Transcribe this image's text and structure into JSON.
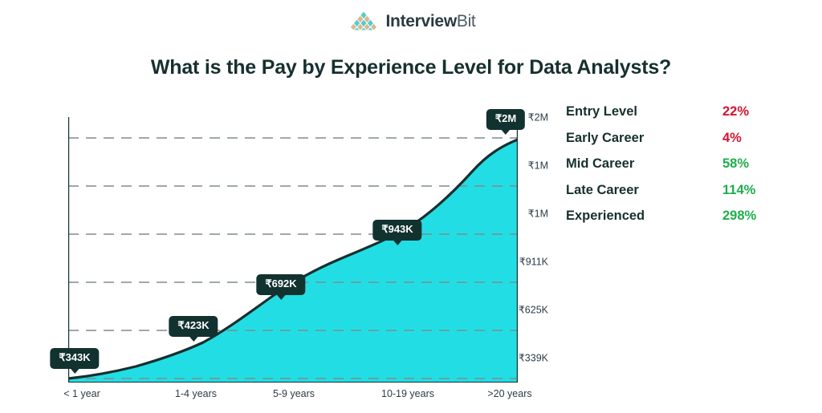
{
  "brand": {
    "logo_icon": "interviewbit-pyramid-logo-icon",
    "name_bold": "Interview",
    "name_light": "Bit",
    "colors": {
      "teal": "#5bc8cf",
      "tan": "#d8b98f",
      "text": "#2b3a42"
    }
  },
  "header": {
    "title": "What is the Pay by Experience Level for Data Analysts?",
    "title_color": "#16302e"
  },
  "chart_data": {
    "type": "area",
    "title": "What is the Pay by Experience Level for Data Analysts?",
    "xlabel": "",
    "ylabel": "",
    "grid": true,
    "legend_position": "right",
    "categories": [
      "< 1 year",
      "1-4 years",
      "5-9 years",
      "10-19 years",
      ">20 years"
    ],
    "values": [
      343000,
      423000,
      692000,
      943000,
      2000000
    ],
    "point_labels": [
      "₹343K",
      "₹423K",
      "₹692K",
      "₹943K",
      "₹2M"
    ],
    "y_ticks": [
      "₹2M",
      "₹1M",
      "₹1M",
      "₹911K",
      "₹625K",
      "₹339K"
    ],
    "ylim": [
      339000,
      2000000
    ],
    "series": [
      {
        "name": "Pay by Experience Level",
        "values": [
          343000,
          423000,
          692000,
          943000,
          2000000
        ]
      }
    ],
    "area_fill_color": "#22dee4",
    "line_color": "#16302e",
    "gridline_color": "#9aa7ad",
    "axis_color": "#16302e",
    "tooltip_bg": "#12322f",
    "tooltip_text_color": "#ffffff"
  },
  "legend": {
    "rows": [
      {
        "label": "Entry Level",
        "value": "22%",
        "trend": "down"
      },
      {
        "label": "Early Career",
        "value": "4%",
        "trend": "down"
      },
      {
        "label": "Mid Career",
        "value": "58%",
        "trend": "up"
      },
      {
        "label": "Late Career",
        "value": "114%",
        "trend": "up"
      },
      {
        "label": "Experienced",
        "value": "298%",
        "trend": "up"
      }
    ],
    "color_up": "#1dae4a",
    "color_down": "#d5132e"
  }
}
